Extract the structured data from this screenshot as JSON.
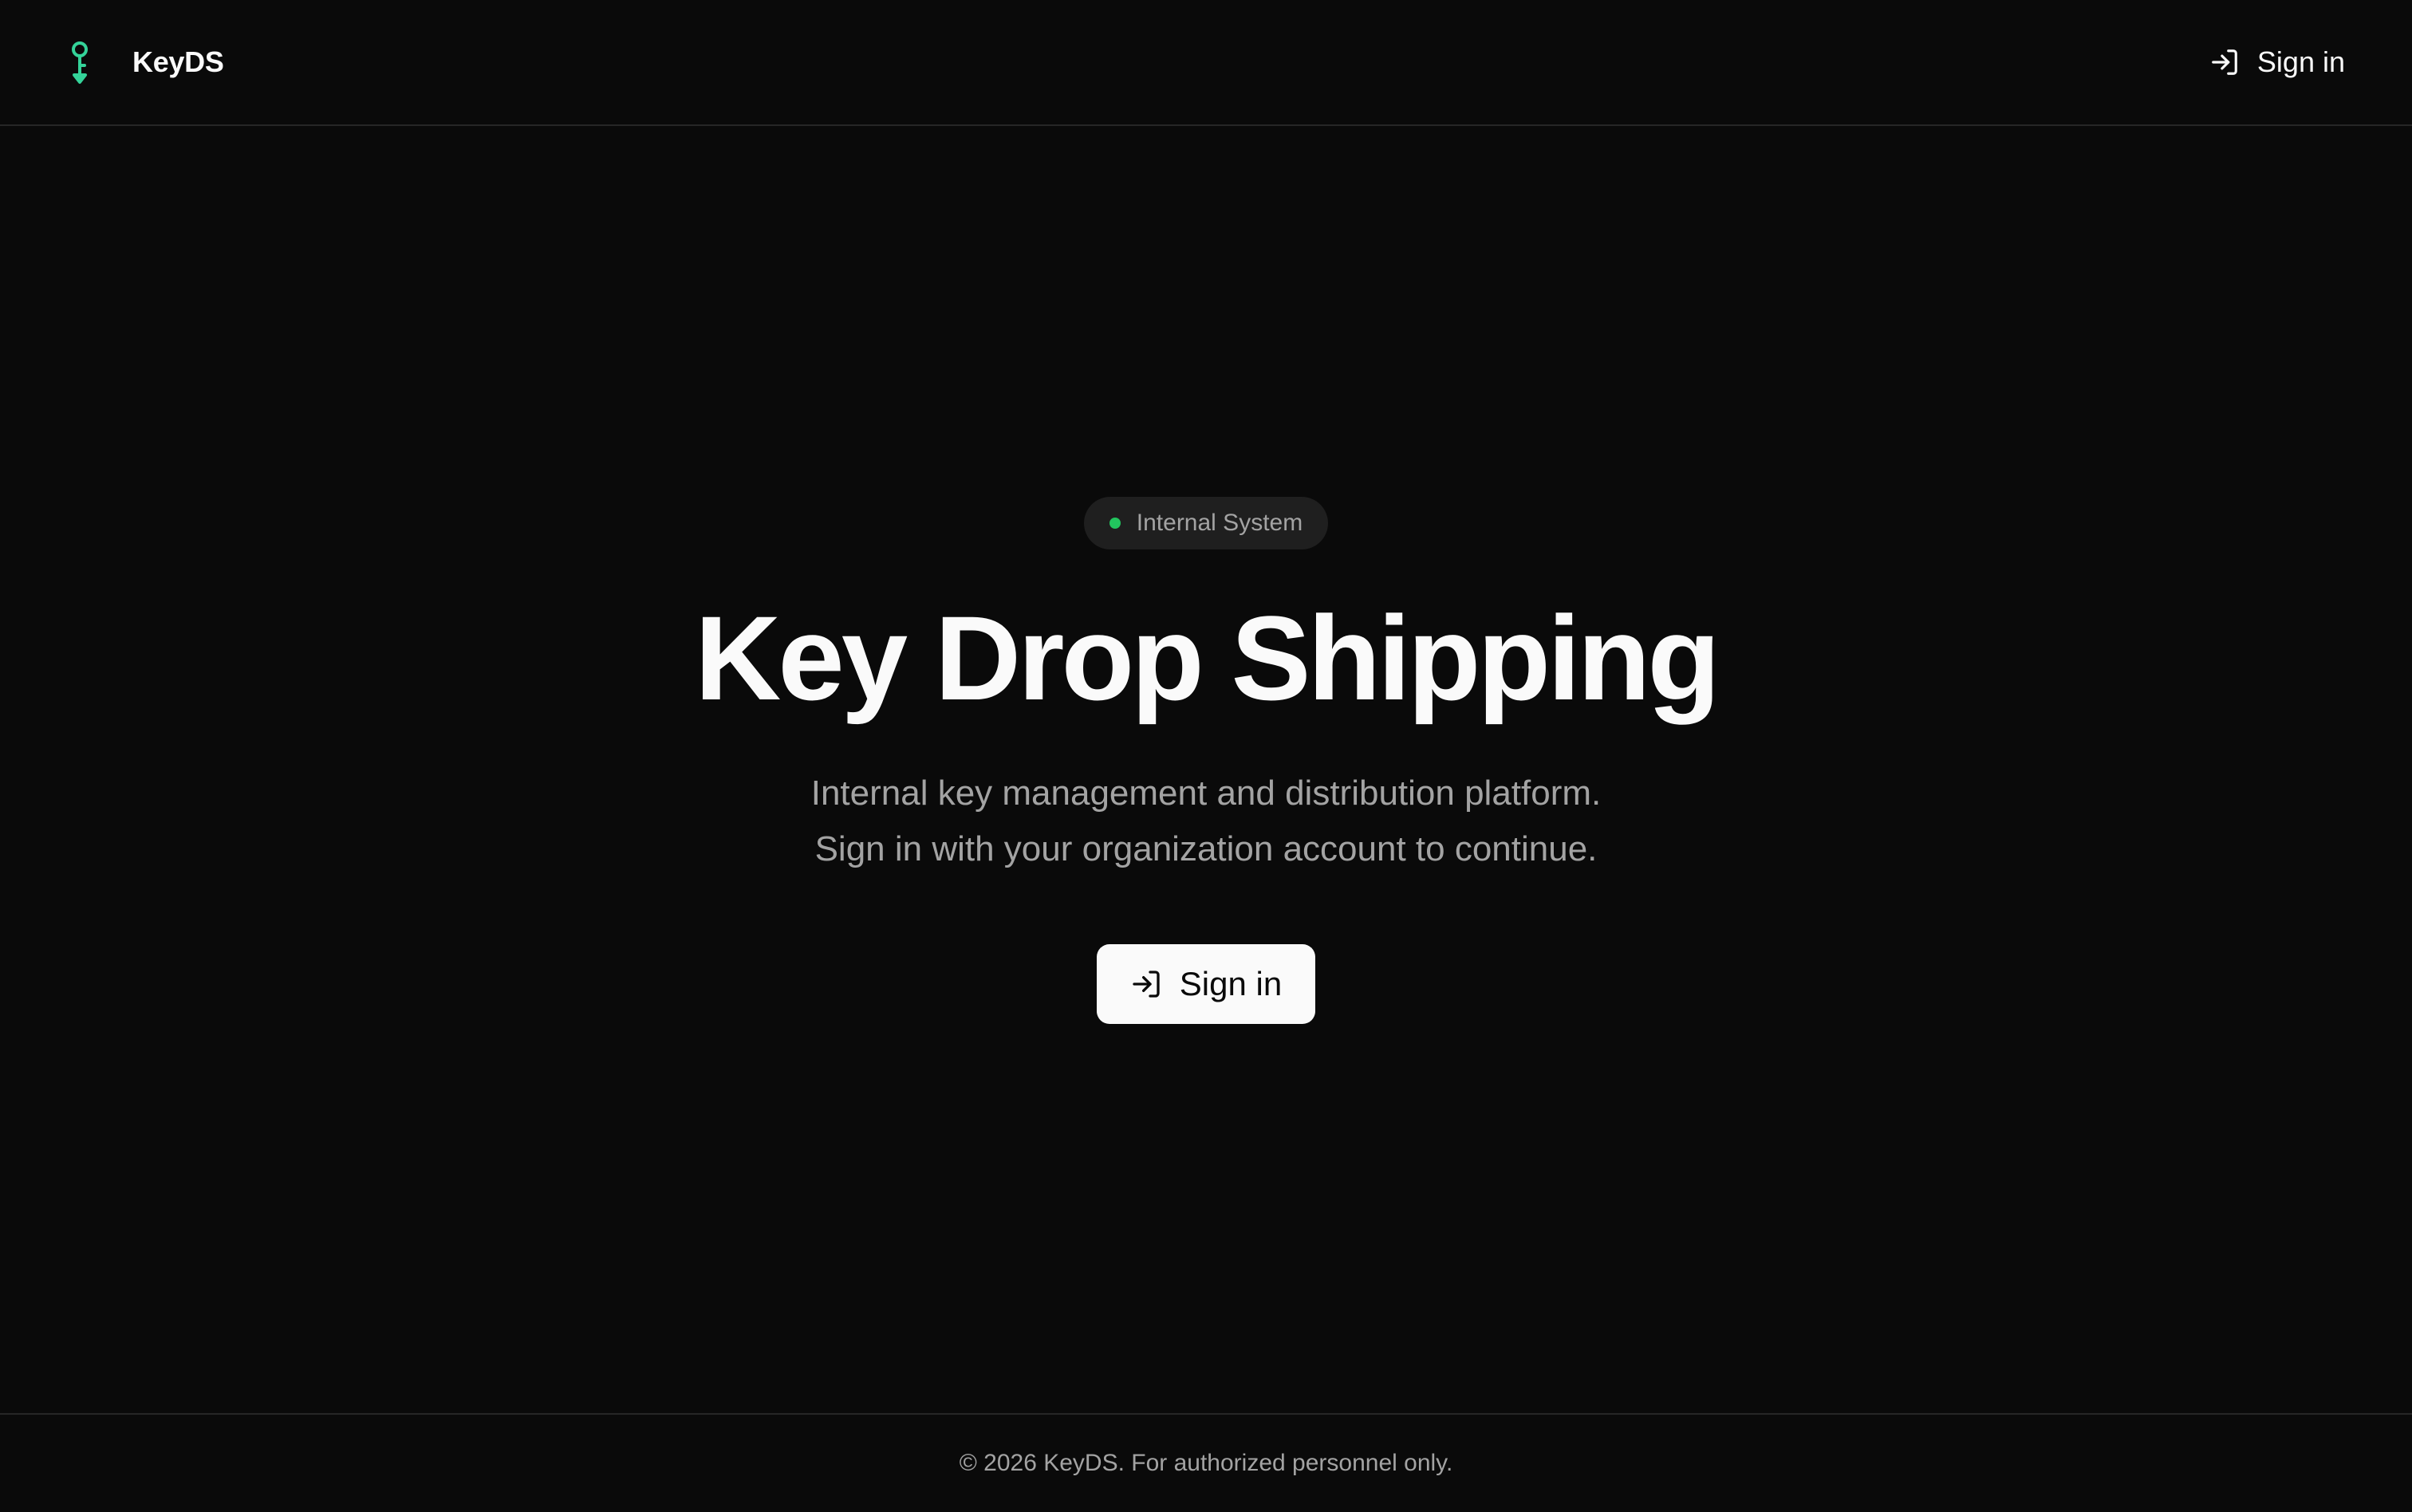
{
  "header": {
    "brand_name": "KeyDS",
    "brand_icon": "key-icon",
    "signin_label": "Sign in",
    "signin_icon": "log-in-icon"
  },
  "hero": {
    "badge_label": "Internal System",
    "title": "Key Drop Shipping",
    "subtitle_line1": "Internal key management and distribution platform.",
    "subtitle_line2": "Sign in with your organization account to continue.",
    "cta_label": "Sign in",
    "cta_icon": "log-in-icon"
  },
  "footer": {
    "text": "© 2026 KeyDS. For authorized personnel only."
  },
  "colors": {
    "background": "#0a0a0a",
    "accent_green": "#22c55e",
    "brand_icon": "#34d399",
    "text_primary": "#fafafa",
    "text_muted": "#a3a3a3",
    "border": "#262626",
    "badge_bg": "#1f1f1f"
  }
}
